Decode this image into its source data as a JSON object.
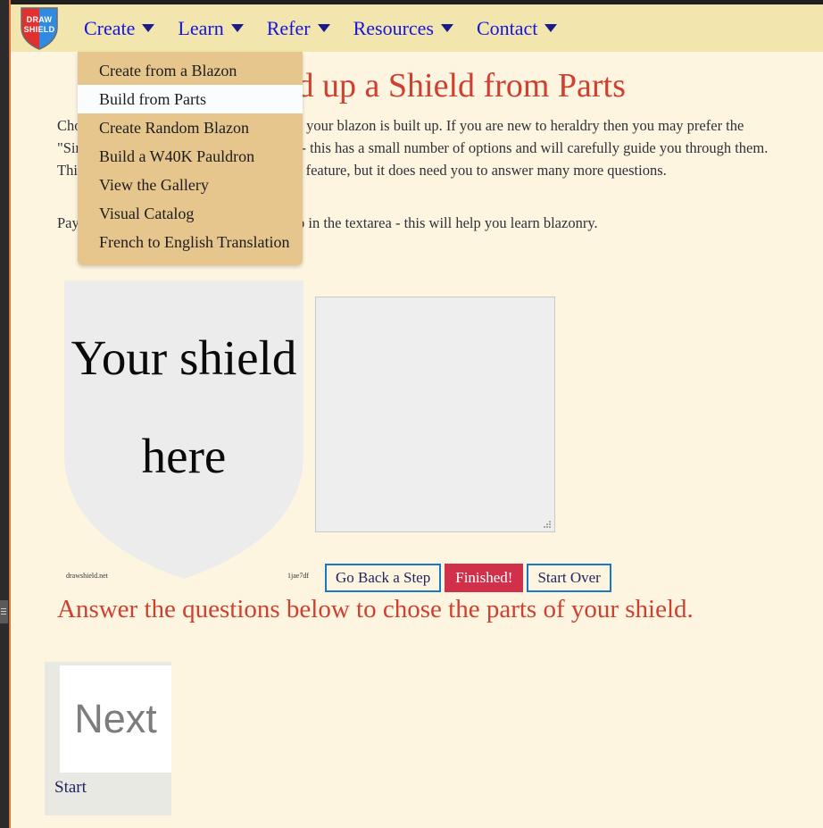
{
  "browser": {
    "left_scrollbar": "left-scrollbar"
  },
  "header": {
    "logo": {
      "line1": "DRAW",
      "line2": "SHIELD",
      "left_color": "#e03030",
      "right_color": "#2f8ae0"
    },
    "nav": [
      {
        "label": "Create",
        "caret": "chevron-down-icon"
      },
      {
        "label": "Learn",
        "caret": "chevron-down-icon"
      },
      {
        "label": "Refer",
        "caret": "chevron-down-icon"
      },
      {
        "label": "Resources",
        "caret": "chevron-down-icon"
      },
      {
        "label": "Contact",
        "caret": "chevron-down-icon"
      }
    ],
    "nav_link_color": "#1414e0",
    "bar_color": "#f2e6ae"
  },
  "dropdown": {
    "owner": "Create",
    "background": "#e6c68d",
    "items": [
      {
        "label": "Create from a Blazon",
        "active": false
      },
      {
        "label": "Build from Parts",
        "active": true
      },
      {
        "label": "Create Random Blazon",
        "active": false
      },
      {
        "label": "Build a W40K Pauldron",
        "active": false
      },
      {
        "label": "View the Gallery",
        "active": false
      },
      {
        "label": "Visual Catalog",
        "active": false
      },
      {
        "label": "French to English Translation",
        "active": false
      }
    ]
  },
  "main": {
    "title": "Build up a Shield from Parts",
    "title_color": "#cf4030",
    "paragraph_1": "Choose the options below and watch how your blazon is built up. If you are new to heraldry then you may prefer the \"Simple\" option under the \"Learn\" menu - this has a small number of options and will carefully guide you through them. This page gives you access to many more feature, but it does need you to answer many more questions.",
    "paragraph_2": "Pay attention to the blazon as it is built up in the textarea - this will help you learn blazonry.",
    "shield": {
      "placeholder_text": "Your shield here",
      "credit": "drawshield.net",
      "hash": "1jae7df",
      "fill_color": "#ececed"
    },
    "blazon_textarea": {
      "value": "",
      "placeholder": ""
    },
    "buttons": [
      {
        "label": "Go Back a Step",
        "style": "outline"
      },
      {
        "label": "Finished!",
        "style": "danger"
      },
      {
        "label": "Start Over",
        "style": "outline"
      }
    ],
    "question_heading": "Answer the questions below to chose the parts of your shield.",
    "options": [
      {
        "thumb_label": "Next",
        "caption": "Start"
      }
    ]
  }
}
